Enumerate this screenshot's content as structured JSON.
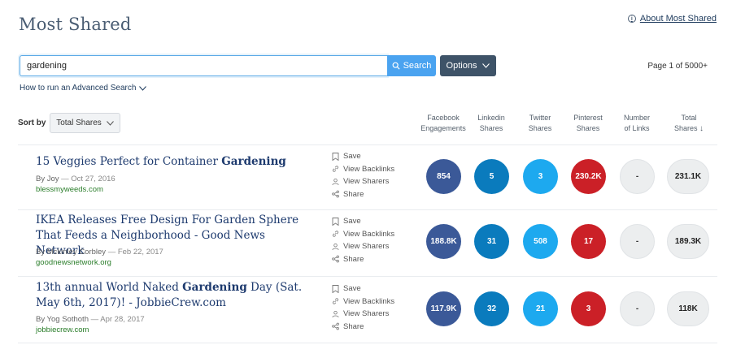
{
  "header": {
    "title": "Most Shared",
    "about_link": "About Most Shared",
    "info_icon": "i"
  },
  "search": {
    "value": "gardening",
    "button_label": "Search",
    "options_label": "Options",
    "page_count": "Page 1 of 5000+",
    "advanced_link": "How to run an Advanced Search"
  },
  "sort": {
    "label": "Sort by",
    "selected": "Total Shares"
  },
  "columns": [
    {
      "line1": "Facebook",
      "line2": "Engagements"
    },
    {
      "line1": "Linkedin",
      "line2": "Shares"
    },
    {
      "line1": "Twitter",
      "line2": "Shares"
    },
    {
      "line1": "Pinterest",
      "line2": "Shares"
    },
    {
      "line1": "Number",
      "line2": "of Links"
    },
    {
      "line1": "Total",
      "line2": "Shares",
      "sort_arrow": "↓"
    }
  ],
  "actions": {
    "save": "Save",
    "backlinks": "View Backlinks",
    "sharers": "View Sharers",
    "share": "Share"
  },
  "colors": {
    "facebook": "#3b5998",
    "linkedin": "#0a7bbd",
    "twitter": "#1da9ef",
    "pinterest": "#cb2027",
    "accent": "#4aa3f0",
    "title": "#1d3a6e",
    "domain": "#2a7d2a"
  },
  "articles": [
    {
      "title_plain": "15 Veggies Perfect for Container ",
      "title_bold": "Gardening",
      "title_rest": "",
      "author": "By Joy",
      "date": "Oct 27, 2016",
      "domain": "blessmyweeds.com",
      "facebook": "854",
      "linkedin": "5",
      "twitter": "3",
      "pinterest": "230.2K",
      "links": "-",
      "total": "231.1K"
    },
    {
      "title_plain": "IKEA Releases Free Design For Garden Sphere That Feeds a Neighborhood - Good News Network",
      "title_bold": "",
      "title_rest": "",
      "author": "By Mckinley Corbley",
      "date": "Feb 22, 2017",
      "domain": "goodnewsnetwork.org",
      "facebook": "188.8K",
      "linkedin": "31",
      "twitter": "508",
      "pinterest": "17",
      "links": "-",
      "total": "189.3K"
    },
    {
      "title_plain": "13th annual World Naked ",
      "title_bold": "Gardening",
      "title_rest": " Day (Sat. May 6th, 2017)! - JobbieCrew.com",
      "author": "By Yog Sothoth",
      "date": "Apr 28, 2017",
      "domain": "jobbiecrew.com",
      "facebook": "117.9K",
      "linkedin": "32",
      "twitter": "21",
      "pinterest": "3",
      "links": "-",
      "total": "118K"
    }
  ]
}
